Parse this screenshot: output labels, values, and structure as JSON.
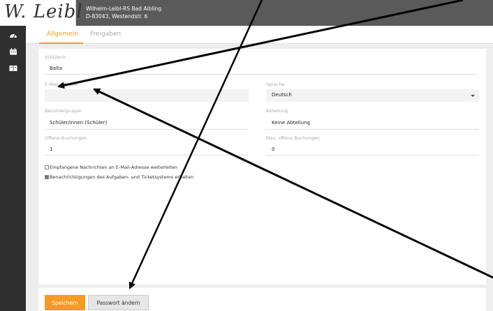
{
  "header": {
    "logo_text": "W. Leibl",
    "school_name": "Wilhelm-Leibl-RS Bad Aibling",
    "school_address": "D-83043, Westendstr. 6"
  },
  "sidebar": {
    "icons": [
      "dashboard-icon",
      "calendar-icon",
      "book-icon"
    ]
  },
  "tabs": [
    {
      "label": "Allgemein",
      "active": true
    },
    {
      "label": "Freigaben",
      "active": false
    }
  ],
  "form": {
    "schuelerin": {
      "label": "Schülerin",
      "value": "Balta"
    },
    "email": {
      "label": "E-Mail-Adresse",
      "value": ""
    },
    "sprache": {
      "label": "Sprache",
      "value": "Deutsch"
    },
    "benutzergruppe": {
      "label": "Benutzergruppe",
      "value": "Schüler/innen (Schüler)"
    },
    "abteilung": {
      "label": "Abteilung",
      "value": "Keine Abteilung"
    },
    "offene_buchungen": {
      "label": "Offene Buchungen",
      "value": "1"
    },
    "max_offene_buchungen": {
      "label": "Max. offene Buchungen",
      "value": "0"
    },
    "checkbox_forward": {
      "label": "Empfangene Nachrichten an E-Mail-Adresse weiterleiten",
      "checked": false
    },
    "checkbox_notifications": {
      "label": "Benachrichtigungen des Aufgaben- und Ticketsystems erhalten",
      "checked": true
    }
  },
  "footer": {
    "save_label": "Speichern",
    "password_label": "Passwort ändern"
  },
  "colors": {
    "accent": "#f59a23",
    "topbar": "#5a5a5a",
    "sidebar": "#2f2f2f",
    "annotation_arrow": "#000000"
  }
}
